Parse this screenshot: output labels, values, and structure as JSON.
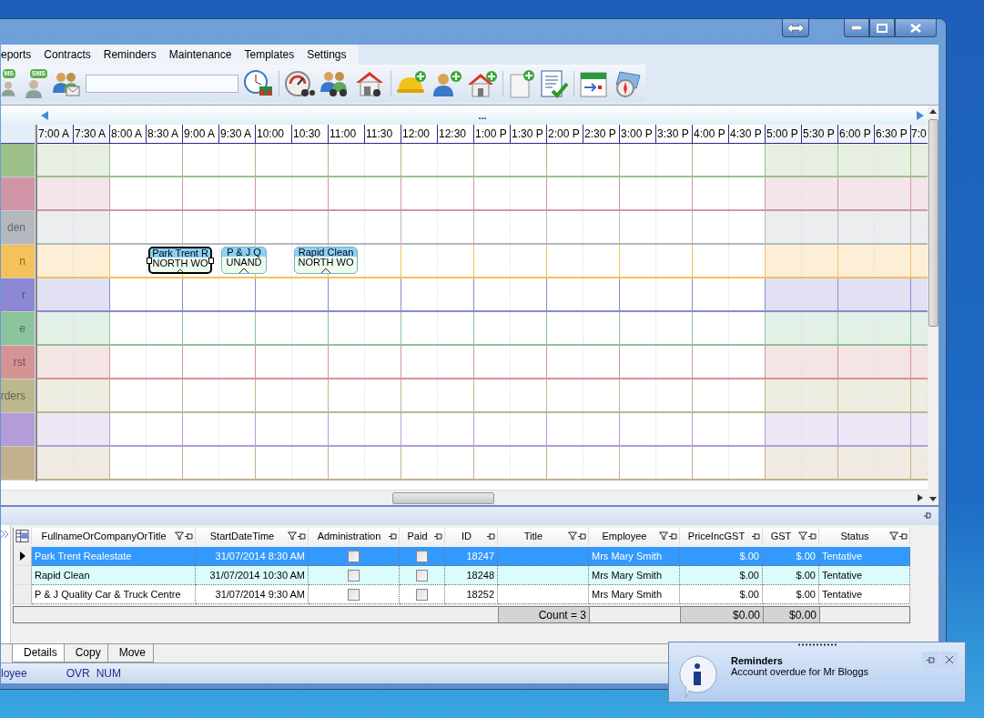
{
  "menu": [
    "eports",
    "Contracts",
    "Reminders",
    "Maintenance",
    "Templates",
    "Settings"
  ],
  "toolbar": {
    "sms_badges": [
      "MS",
      "SMS"
    ]
  },
  "scheduler": {
    "nav_label": "...",
    "time_slots": [
      {
        "label": "7:00 A",
        "off": true
      },
      {
        "label": "7:30 A",
        "off": true
      },
      {
        "label": "8:00 A",
        "off": false
      },
      {
        "label": "8:30 A",
        "off": false
      },
      {
        "label": "9:00 A",
        "off": false
      },
      {
        "label": "9:30 A",
        "off": false
      },
      {
        "label": "10:00",
        "off": false
      },
      {
        "label": "10:30",
        "off": false
      },
      {
        "label": "11:00",
        "off": false
      },
      {
        "label": "11:30",
        "off": false
      },
      {
        "label": "12:00",
        "off": false
      },
      {
        "label": "12:30",
        "off": false
      },
      {
        "label": "1:00 P",
        "off": false
      },
      {
        "label": "1:30 P",
        "off": false
      },
      {
        "label": "2:00 P",
        "off": false
      },
      {
        "label": "2:30 P",
        "off": false
      },
      {
        "label": "3:00 P",
        "off": false
      },
      {
        "label": "3:30 P",
        "off": false
      },
      {
        "label": "4:00 P",
        "off": false
      },
      {
        "label": "4:30 P",
        "off": false
      },
      {
        "label": "5:00 P",
        "off": true
      },
      {
        "label": "5:30 P",
        "off": true
      },
      {
        "label": "6:00 P",
        "off": true
      },
      {
        "label": "6:30 P",
        "off": true
      },
      {
        "label": "7:0",
        "off": true
      }
    ],
    "resources": [
      {
        "color": "#9dc08b"
      },
      {
        "color": "#d096a8"
      },
      {
        "color": "#b4b8bf",
        "label": "den"
      },
      {
        "color": "#f5c15a",
        "label": "n",
        "appointments": [
          {
            "title": "Park Trent R",
            "location": "NORTH WO",
            "selected": true
          },
          {
            "title": "P & J Q",
            "location": "UNAND",
            "selected": false
          },
          {
            "title": "Rapid Clean",
            "location": "NORTH WO",
            "selected": false
          }
        ]
      },
      {
        "color": "#8c88d4",
        "label": "r"
      },
      {
        "color": "#8cc49c",
        "label": "e"
      },
      {
        "color": "#d49494",
        "label": "rst"
      },
      {
        "color": "#bcb88c",
        "label": "rders"
      },
      {
        "color": "#b49cd8"
      },
      {
        "color": "#c4b08c"
      }
    ]
  },
  "grid": {
    "columns": [
      {
        "label": "FullnameOrCompanyOrTitle",
        "filter": true
      },
      {
        "label": "StartDateTime",
        "filter": true
      },
      {
        "label": "Administration",
        "filter": false
      },
      {
        "label": "Paid",
        "filter": false
      },
      {
        "label": "ID",
        "filter": false
      },
      {
        "label": "Title",
        "filter": true
      },
      {
        "label": "Employee",
        "filter": true
      },
      {
        "label": "PriceIncGST",
        "filter": false
      },
      {
        "label": "GST",
        "filter": true
      },
      {
        "label": "Status",
        "filter": true
      }
    ],
    "rows": [
      {
        "selected": true,
        "name": "Park Trent Realestate",
        "start": "31/07/2014 8:30 AM",
        "administration": false,
        "paid": false,
        "id": "18247",
        "employee": "Mrs Mary Smith",
        "price": "$.00",
        "gst": "$.00",
        "status": "Tentative"
      },
      {
        "selected": false,
        "name": "Rapid Clean",
        "start": "31/07/2014 10:30 AM",
        "administration": false,
        "paid": false,
        "id": "18248",
        "employee": "Mrs Mary Smith",
        "price": "$.00",
        "gst": "$.00",
        "status": "Tentative"
      },
      {
        "selected": false,
        "name": "P & J Quality Car & Truck Centre",
        "start": "31/07/2014 9:30 AM",
        "administration": false,
        "paid": false,
        "id": "18252",
        "employee": "Mrs Mary Smith",
        "price": "$.00",
        "gst": "$.00",
        "status": "Tentative"
      }
    ],
    "footer": {
      "count": "Count = 3",
      "price": "$0.00",
      "gst": "$0.00"
    }
  },
  "tabs": [
    {
      "label": "Details",
      "selected": true
    },
    {
      "label": "Copy",
      "selected": false
    },
    {
      "label": "Move",
      "selected": false
    }
  ],
  "status_bar": [
    "loyee",
    "OVR",
    "NUM"
  ],
  "notification": {
    "title": "Reminders",
    "message": "Account overdue for Mr Bloggs"
  }
}
